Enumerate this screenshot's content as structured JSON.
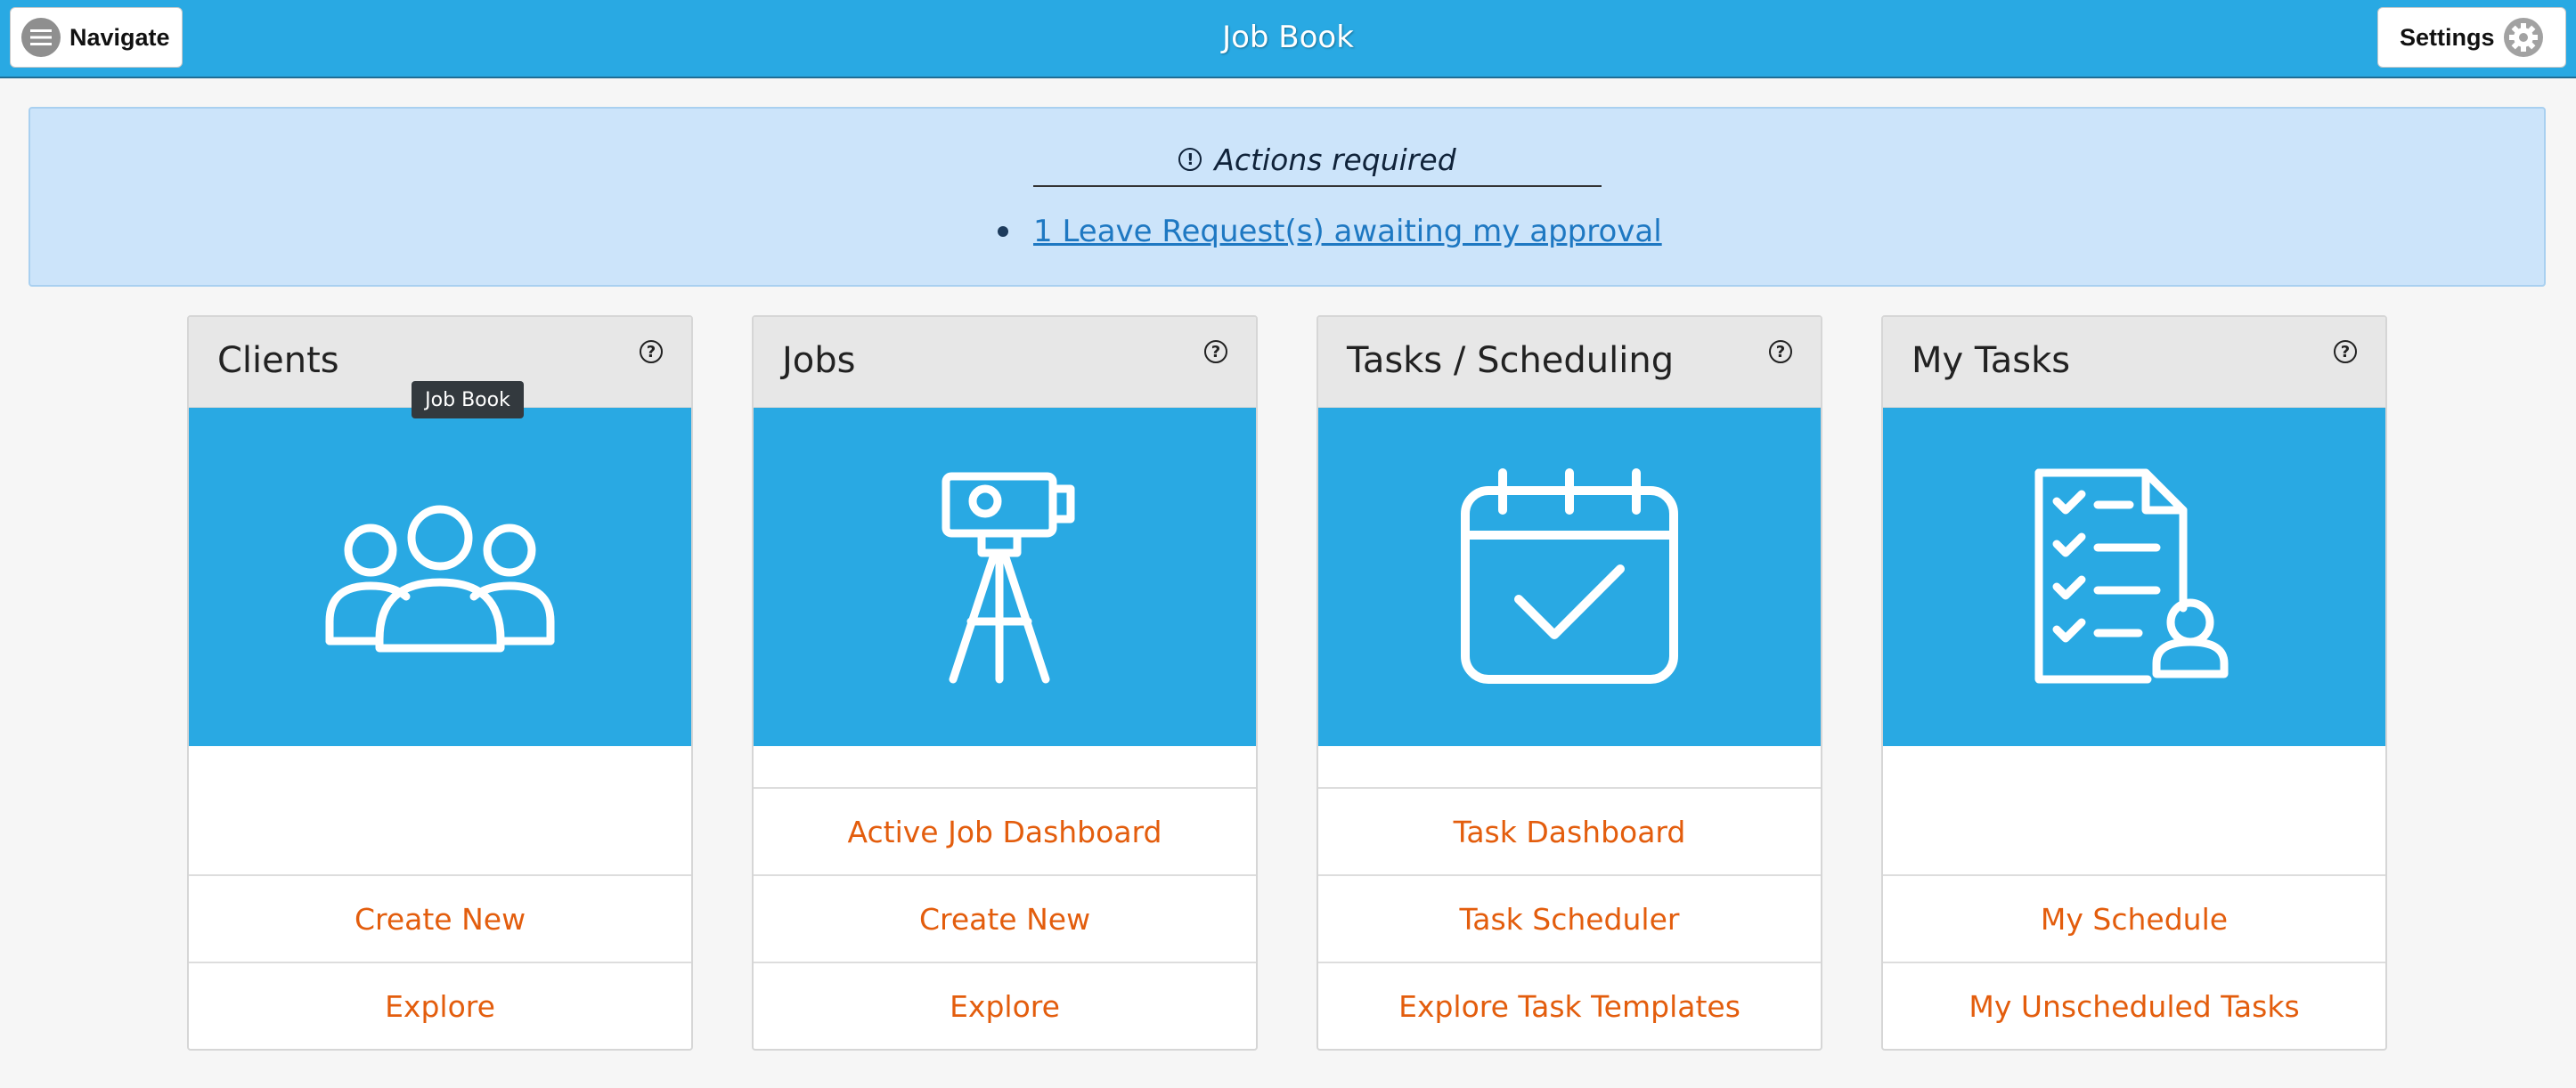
{
  "header": {
    "title": "Job Book",
    "navigate_label": "Navigate",
    "settings_label": "Settings"
  },
  "alert": {
    "heading": "Actions required",
    "items": [
      "1 Leave Request(s) awaiting my approval"
    ]
  },
  "tooltip": "Job Book",
  "cards": [
    {
      "title": "Clients",
      "icon": "clients-group-icon",
      "links": [
        "Create New",
        "Explore"
      ]
    },
    {
      "title": "Jobs",
      "icon": "survey-tripod-icon",
      "links": [
        "Active Job Dashboard",
        "Create New",
        "Explore"
      ]
    },
    {
      "title": "Tasks / Scheduling",
      "icon": "calendar-check-icon",
      "links": [
        "Task Dashboard",
        "Task Scheduler",
        "Explore Task Templates"
      ]
    },
    {
      "title": "My Tasks",
      "icon": "task-list-user-icon",
      "links": [
        "My Schedule",
        "My Unscheduled Tasks"
      ]
    }
  ],
  "colors": {
    "accent": "#29a9e3",
    "link": "#e35d0d",
    "alert_bg": "#cce4fa"
  }
}
